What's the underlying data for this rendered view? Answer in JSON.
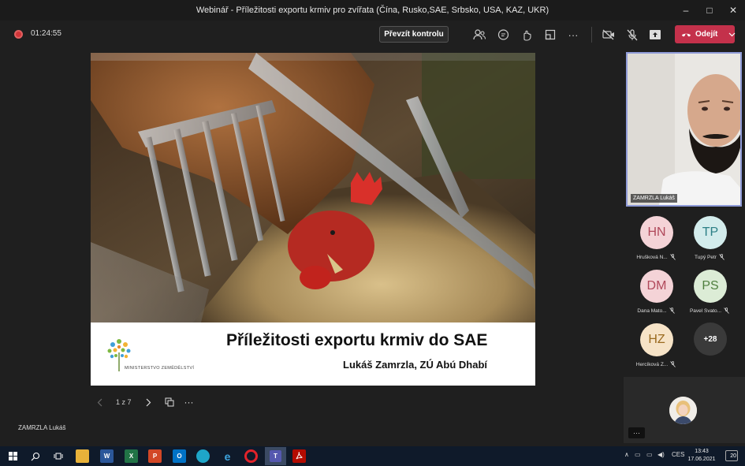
{
  "window": {
    "title": "Webinář - Příležitosti exportu krmiv pro zvířata (Čína, Rusko,SAE, Srbsko, USA, KAZ, UKR)",
    "minimize": "–",
    "maximize": "□",
    "close": "✕"
  },
  "toolbar": {
    "timer": "01:24:55",
    "take_control_label": "Převzít kontrolu",
    "leave_label": "Odejít",
    "more_dots": "···"
  },
  "slide": {
    "title": "Příležitosti exportu krmiv do SAE",
    "subtitle": "Lukáš Zamrzla, ZÚ Abú Dhabí",
    "ministry": "MINISTERSTVO ZEMĚDĚLSTVÍ",
    "page_indicator": "1 z 7"
  },
  "presenter": {
    "name": "ZAMRZLA Lukáš"
  },
  "video": {
    "name": "ZAMRZLA Lukáš"
  },
  "participants": [
    {
      "initials": "HN",
      "name": "Hrušková N...",
      "bg": "#f4d3d7",
      "fg": "#b0485a"
    },
    {
      "initials": "TP",
      "name": "Tupý Petr",
      "bg": "#d3ecec",
      "fg": "#2c7f86"
    },
    {
      "initials": "DM",
      "name": "Dana Mato...",
      "bg": "#f4d3d7",
      "fg": "#b0485a"
    },
    {
      "initials": "PS",
      "name": "Pavel Svato...",
      "bg": "#dcecd6",
      "fg": "#4f7f3e"
    },
    {
      "initials": "HZ",
      "name": "Hercíková Z...",
      "bg": "#f6e3c7",
      "fg": "#9a6a1f"
    }
  ],
  "more_participants": "+28",
  "overflow_button": "···",
  "taskbar": {
    "language": "CES",
    "time": "13:43",
    "date": "17.06.2021",
    "notifications": "20"
  },
  "colors": {
    "leave_red": "#c4314b",
    "speaker_border": "#8f9bd8",
    "taskbar_bg": "#0f1a2a"
  }
}
